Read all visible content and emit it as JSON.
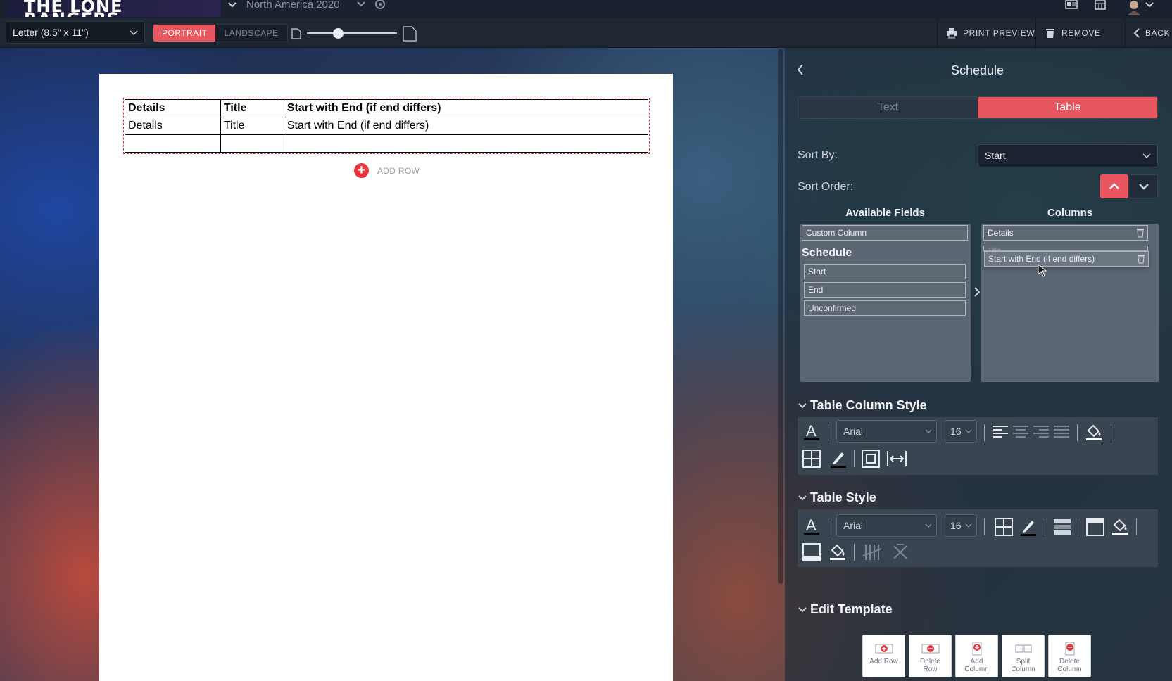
{
  "topbar": {
    "brand": "THE LONE RANGERS",
    "tour": "North America 2020"
  },
  "toolbar": {
    "paper_size": "Letter (8.5\" x 11\")",
    "portrait": "PORTRAIT",
    "landscape": "LANDSCAPE",
    "zoom_level": 0.34,
    "print_preview": "PRINT PREVIEW",
    "remove": "REMOVE",
    "back": "BACK"
  },
  "document": {
    "table": {
      "header": [
        "Details",
        "Title",
        "Start with End (if end differs)"
      ],
      "rows": [
        [
          "Details",
          "Title",
          "Start with End (if end differs)"
        ],
        [
          "",
          "",
          ""
        ]
      ]
    },
    "add_row": "ADD ROW"
  },
  "panel": {
    "title": "Schedule",
    "tabs": [
      {
        "label": "Text",
        "active": false
      },
      {
        "label": "Table",
        "active": true
      }
    ],
    "sort_by_label": "Sort By:",
    "sort_by_value": "Start",
    "sort_order_label": "Sort Order:",
    "available_fields_title": "Available Fields",
    "columns_title": "Columns",
    "custom_column": "Custom Column",
    "group_title": "Schedule",
    "available_fields": [
      "Start",
      "End",
      "Unconfirmed"
    ],
    "columns": [
      "Details",
      "Title",
      "Start with End (if end differs)"
    ],
    "column_style": {
      "title": "Table Column Style",
      "font": "Arial",
      "size": "16"
    },
    "table_style": {
      "title": "Table Style",
      "font": "Arial",
      "size": "16"
    },
    "edit_template": {
      "title": "Edit Template",
      "buttons": [
        [
          "Add Row",
          ""
        ],
        [
          "Delete",
          "Row"
        ],
        [
          "Add",
          "Column"
        ],
        [
          "Split",
          "Column"
        ],
        [
          "Delete",
          "Column"
        ]
      ]
    }
  },
  "colors": {
    "accent": "#e8565f",
    "panel": "#2a3644"
  }
}
